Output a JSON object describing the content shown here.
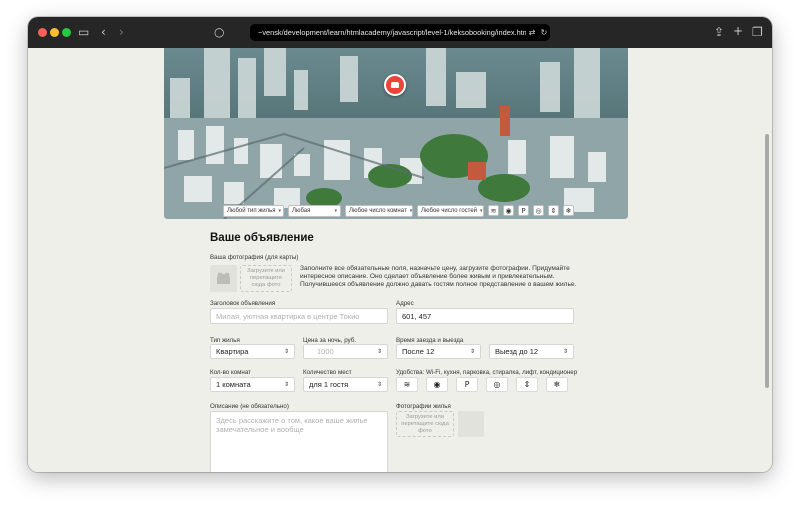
{
  "browser": {
    "url": "~vensk/development/learn/htmlacademy/javascript/level-1/keksobooking/index.html",
    "icons": [
      "sidebar-icon",
      "back-icon",
      "forward-icon",
      "share-icon",
      "new-tab-icon",
      "tabs-overview-icon",
      "reload-icon",
      "translate-icon"
    ]
  },
  "filters": {
    "type": "Любой тип жилья",
    "price": "Любая",
    "rooms": "Любое число комнат",
    "guests": "Любое число гостей"
  },
  "form": {
    "title": "Ваше объявление",
    "avatar_label": "Ваша фотография (для карты)",
    "avatar_upload": "Загрузите или перетащите сюда фото",
    "intro": "Заполните все обязательные поля, назначьте цену, загрузите фотографии. Придумайте интересное описание. Оно сделает объявление более живым и привлекательным. Получившееся объявление должно давать гостям полное представление о вашем жилье.",
    "title_label": "Заголовок объявления",
    "title_placeholder": "Милая, уютная квартирка в центре Токио",
    "address_label": "Адрес",
    "address_value": "601, 457",
    "type_label": "Тип жилья",
    "type_value": "Квартира",
    "price_label": "Цена за ночь, руб.",
    "price_placeholder": "1000",
    "time_label": "Время заезда и выезда",
    "checkin_value": "После 12",
    "checkout_value": "Выезд до 12",
    "rooms_label": "Кол-во комнат",
    "rooms_value": "1 комната",
    "capacity_label": "Количество мест",
    "capacity_value": "для 1 гостя",
    "features_label": "Удобства: Wi-Fi, кухня, парковка, стиралка, лифт, кондиционер",
    "description_label": "Описание (не обязательно)",
    "description_placeholder": "Здесь расскажите о том, какое ваше жилье замечательное и вообще",
    "photos_label": "Фотографии жилья",
    "photos_upload": "Загрузите или перетащите сюда фото"
  }
}
